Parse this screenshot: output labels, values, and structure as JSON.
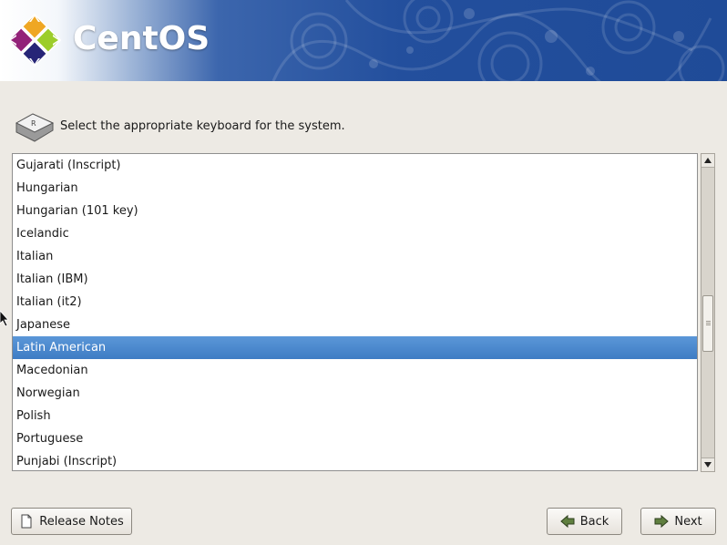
{
  "banner": {
    "brand": "CentOS",
    "logo_icon": "centos-logo-icon",
    "colors": {
      "bg_dark": "#234f9d",
      "bg_light": "#ffffff"
    }
  },
  "prompt": {
    "icon": "keyboard-key-icon",
    "text": "Select the appropriate keyboard for the system."
  },
  "keyboard_list": {
    "items": [
      "Gujarati (Inscript)",
      "Hungarian",
      "Hungarian (101 key)",
      "Icelandic",
      "Italian",
      "Italian (IBM)",
      "Italian (it2)",
      "Japanese",
      "Latin American",
      "Macedonian",
      "Norwegian",
      "Polish",
      "Portuguese",
      "Punjabi (Inscript)"
    ],
    "selected": "Latin American",
    "selection_color": "#4a8ad0"
  },
  "buttons": {
    "release_notes": "Release Notes",
    "back": "Back",
    "next": "Next"
  }
}
